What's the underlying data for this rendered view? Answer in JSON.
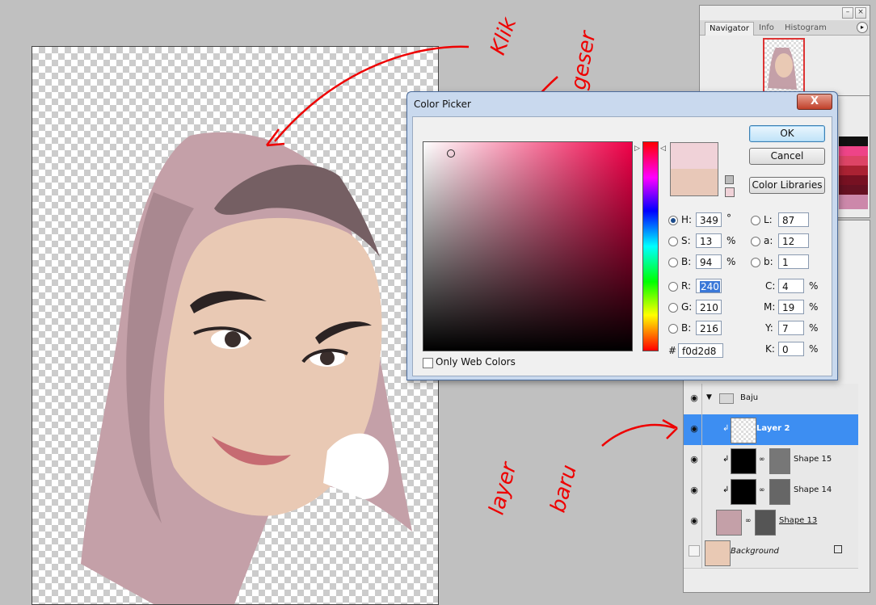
{
  "dialog": {
    "title": "Color Picker",
    "close_label": "X",
    "ok_label": "OK",
    "cancel_label": "Cancel",
    "libraries_label": "Color Libraries",
    "web_colors_label": "Only Web Colors",
    "hsb": {
      "h_label": "H:",
      "h_value": "349",
      "h_unit": "°",
      "s_label": "S:",
      "s_value": "13",
      "s_unit": "%",
      "b_label": "B:",
      "b_value": "94",
      "b_unit": "%"
    },
    "rgb": {
      "r_label": "R:",
      "r_value": "240",
      "g_label": "G:",
      "g_value": "210",
      "b_label": "B:",
      "b_value": "216"
    },
    "lab": {
      "l_label": "L:",
      "l_value": "87",
      "a_label": "a:",
      "a_value": "12",
      "b_label": "b:",
      "b_value": "1"
    },
    "cmyk": {
      "c_label": "C:",
      "c_value": "4",
      "m_label": "M:",
      "m_value": "19",
      "y_label": "Y:",
      "y_value": "7",
      "k_label": "K:",
      "k_value": "0",
      "unit": "%"
    },
    "hex_label": "#",
    "hex_value": "f0d2d8",
    "new_color": "#f0d2d8",
    "current_color": "#e8c8b8"
  },
  "navigator": {
    "tabs": [
      "Navigator",
      "Info",
      "Histogram"
    ]
  },
  "layers": {
    "rows": [
      {
        "name": "Baju",
        "type": "group"
      },
      {
        "name": "Layer 2",
        "selected": true
      },
      {
        "name": "Shape 15"
      },
      {
        "name": "Shape 14"
      },
      {
        "name": "Shape 13"
      },
      {
        "name": "Background"
      }
    ]
  },
  "annotations": {
    "klik": "Klik",
    "geser": "geser",
    "layer": "layer",
    "baru": "baru"
  },
  "colors": {
    "hijab": "#c4a0a8",
    "hijab_dark": "#755f63",
    "skin": "#e9c9b4",
    "selection": "#3d8ef2",
    "annotation": "#e00000"
  }
}
